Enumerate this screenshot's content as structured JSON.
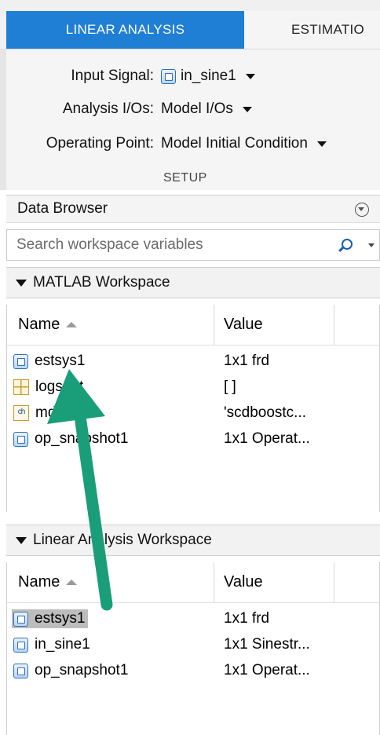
{
  "tabs": [
    {
      "label": "LINEAR ANALYSIS",
      "active": true
    },
    {
      "label": "ESTIMATIO",
      "active": false
    }
  ],
  "setup": {
    "input_signal_label": "Input Signal:",
    "input_signal_value": "in_sine1",
    "analysis_ios_label": "Analysis I/Os:",
    "analysis_ios_value": "Model I/Os",
    "operating_point_label": "Operating Point:",
    "operating_point_value": "Model Initial Condition",
    "section_label": "SETUP"
  },
  "data_browser": {
    "title": "Data Browser",
    "search_placeholder": "Search workspace variables"
  },
  "matlab_workspace": {
    "title": "MATLAB Workspace",
    "columns": {
      "name": "Name",
      "value": "Value"
    },
    "rows": [
      {
        "icon": "system-icon",
        "name": "estsys1",
        "value": "1x1 frd"
      },
      {
        "icon": "table-icon",
        "name": "logsout",
        "value": "[ ]"
      },
      {
        "icon": "char-icon",
        "name": "mdl",
        "value": "'scdboostc..."
      },
      {
        "icon": "system-icon",
        "name": "op_snapshot1",
        "value": "1x1 Operat..."
      }
    ]
  },
  "linear_workspace": {
    "title": "Linear Analysis Workspace",
    "columns": {
      "name": "Name",
      "value": "Value"
    },
    "rows": [
      {
        "icon": "system-icon",
        "name": "estsys1",
        "value": "1x1 frd",
        "selected": true
      },
      {
        "icon": "system-icon",
        "name": "in_sine1",
        "value": "1x1 Sinestr..."
      },
      {
        "icon": "system-icon",
        "name": "op_snapshot1",
        "value": "1x1 Operat..."
      }
    ]
  },
  "colors": {
    "tab_active": "#1f7fd4",
    "annotation_arrow": "#1a9e7a",
    "selection": "#bdbdbd"
  }
}
